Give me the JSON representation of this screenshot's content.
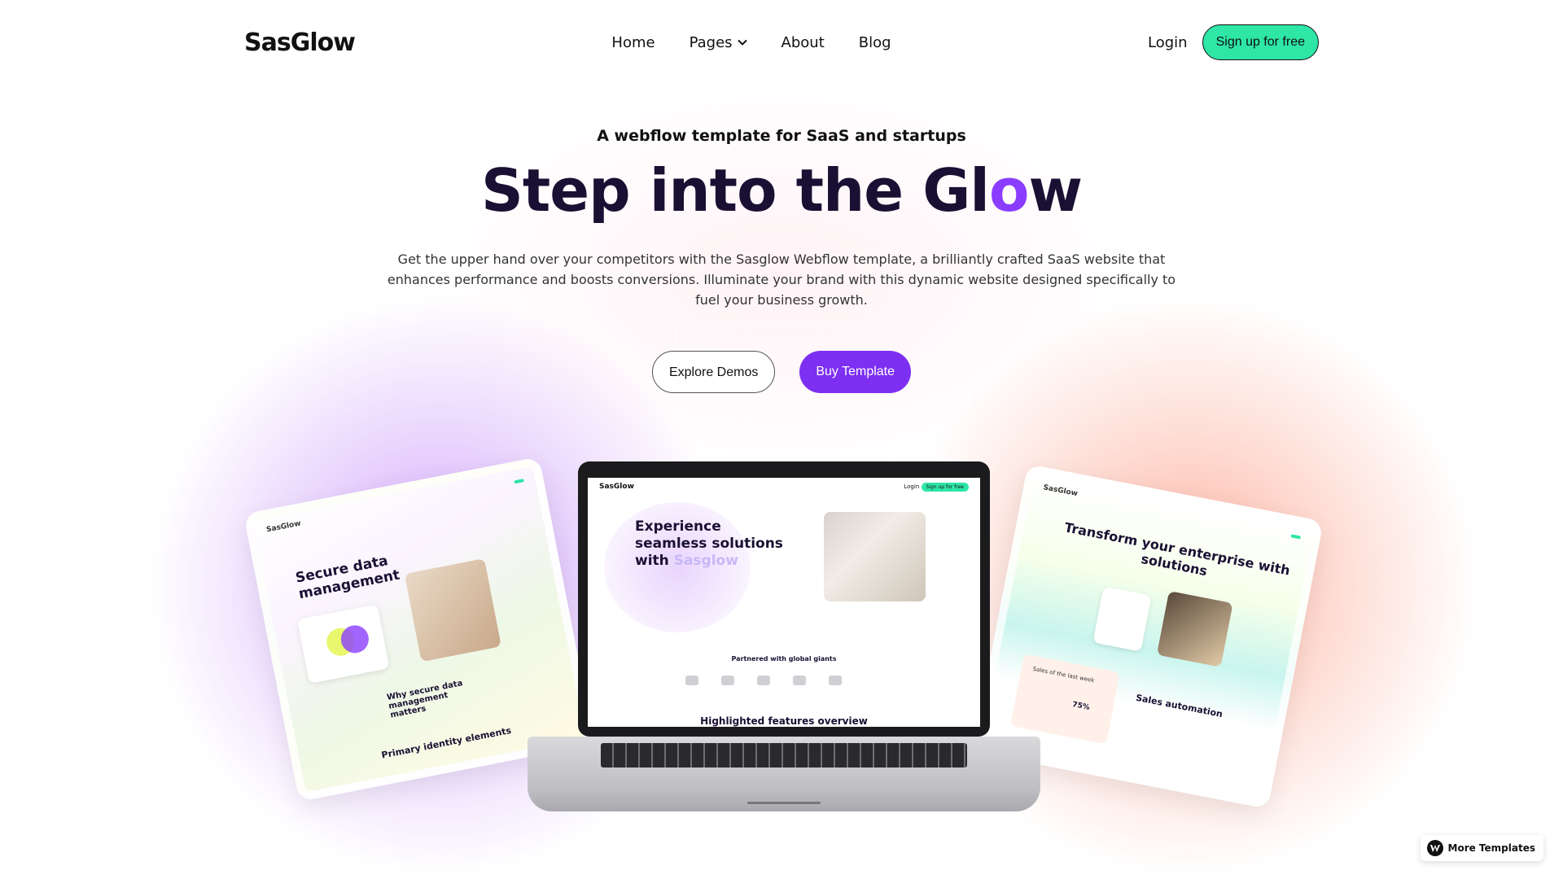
{
  "nav": {
    "logo": "SasGlow",
    "links": [
      "Home",
      "Pages",
      "About",
      "Blog"
    ],
    "login": "Login",
    "signup": "Sign up for free"
  },
  "hero": {
    "eyebrow": "A webflow template for SaaS and startups",
    "headline_pre": "Step into the Gl",
    "headline_accent": "o",
    "headline_post": "w",
    "subtext": "Get the upper hand over your competitors with the Sasglow Webflow template, a brilliantly crafted SaaS website that enhances performance and boosts conversions. Illuminate your brand with this dynamic website designed specifically to fuel your business growth.",
    "cta_secondary": "Explore Demos",
    "cta_primary": "Buy Template"
  },
  "mockups": {
    "left": {
      "logo": "SasGlow",
      "title": "Secure data management",
      "subtitle": "Why secure data management matters",
      "footer": "Primary identity elements"
    },
    "center": {
      "logo": "SasGlow",
      "login": "Login",
      "signup": "Sign up for free",
      "title_line1": "Experience",
      "title_line2": "seamless solutions",
      "title_line3_a": "with ",
      "title_line3_b": "Sasglow",
      "partners": "Partnered with global giants",
      "features": "Highlighted features overview"
    },
    "right": {
      "logo": "SasGlow",
      "title": "Transform your enterprise with",
      "title_tail": "solutions",
      "sub": "Sales automation",
      "sub2": "Sales of the last week",
      "percent": "75%"
    }
  },
  "badge": {
    "label": "More Templates",
    "icon": "webflow-icon"
  },
  "colors": {
    "accent": "#7d2ff2",
    "signup_bg": "#2ee6a6",
    "headline": "#1a1033"
  }
}
